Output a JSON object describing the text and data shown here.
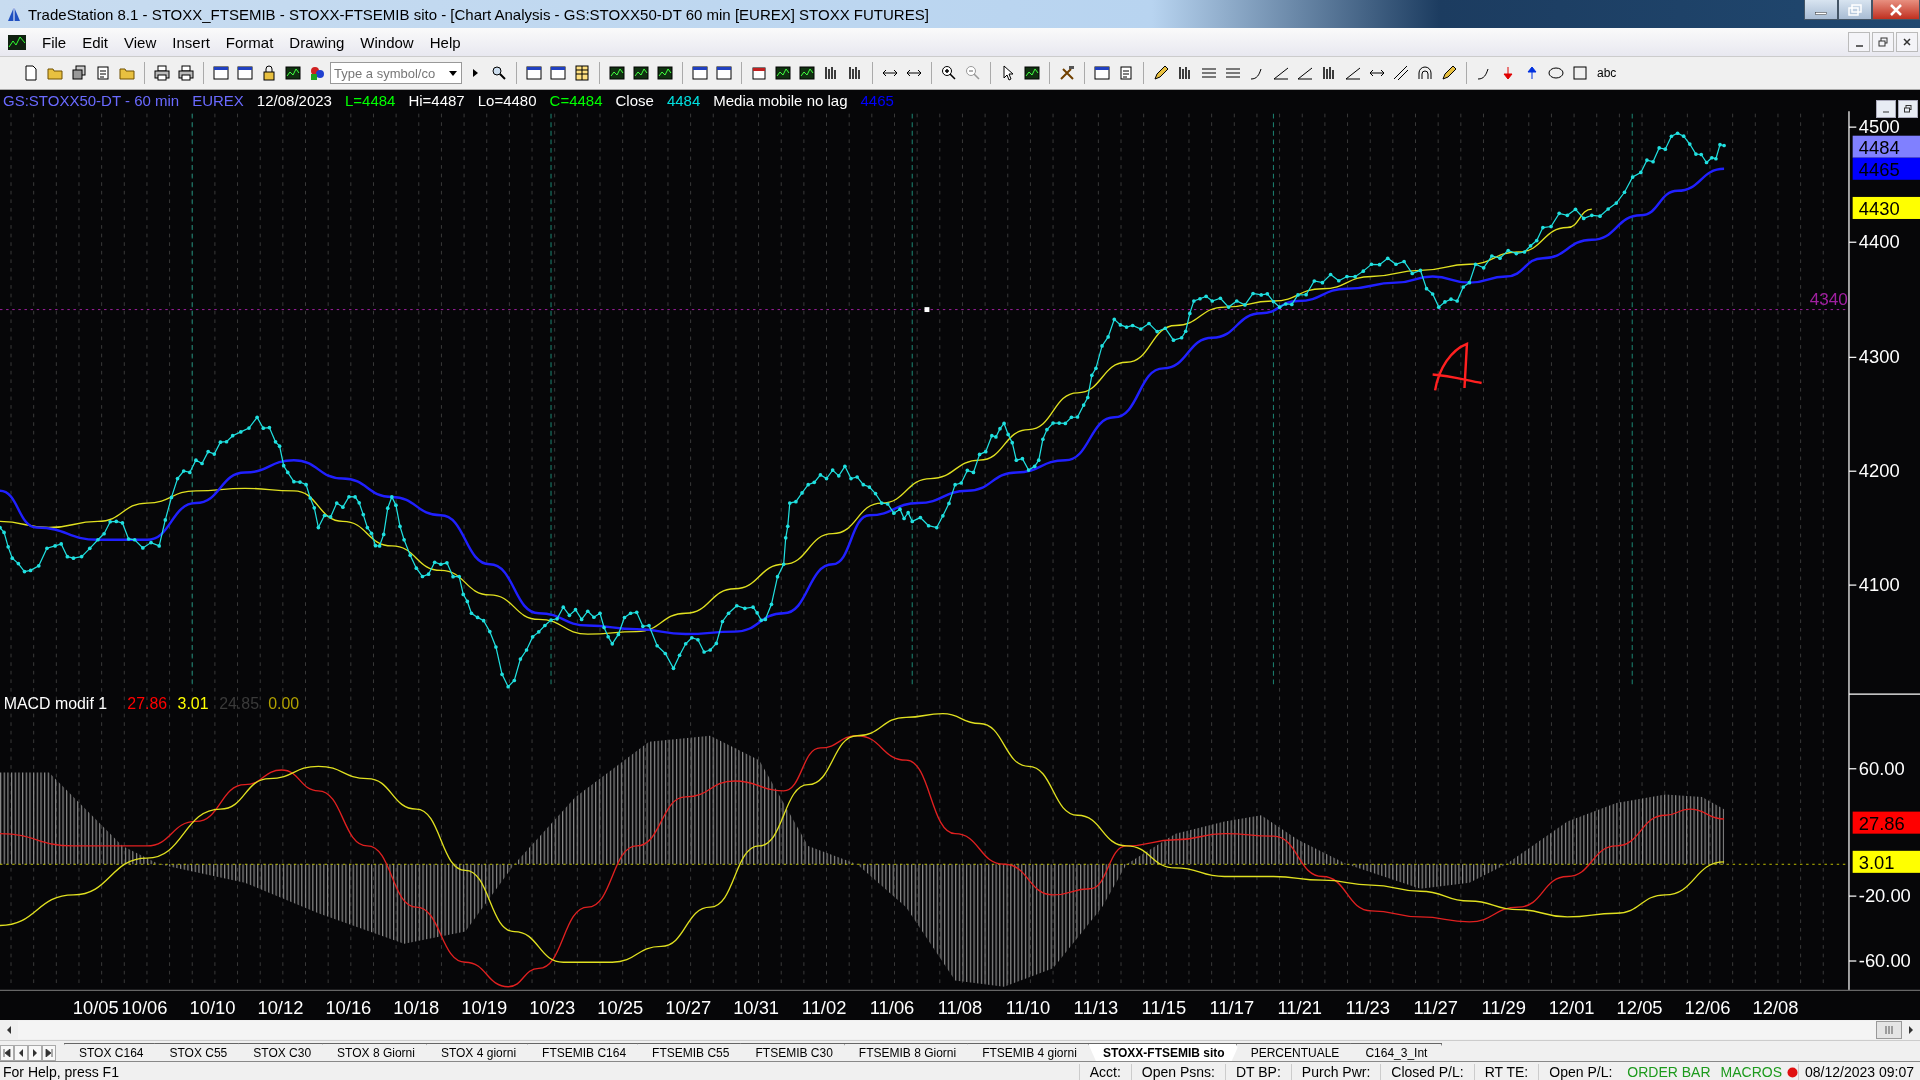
{
  "window": {
    "title": "TradeStation 8.1 - STOXX_FTSEMIB - STOXX-FTSEMIB sito - [Chart Analysis - GS:STOXX50-DT  60 min  [EUREX] STOXX FUTURES]"
  },
  "menu": [
    "File",
    "Edit",
    "View",
    "Insert",
    "Format",
    "Drawing",
    "Window",
    "Help"
  ],
  "toolbar": {
    "symbol_field": {
      "placeholder": "Type a symbol/co"
    },
    "text_tool": "abc"
  },
  "chart": {
    "header": [
      {
        "text": "GS:STOXX50-DT - 60 min",
        "color": "#6a6aff"
      },
      {
        "text": "EUREX",
        "color": "#6a6aff"
      },
      {
        "text": "12/08/2023",
        "color": "#ffffff"
      },
      {
        "text": "L=4484",
        "color": "#00ff00"
      },
      {
        "text": "Hi=4487",
        "color": "#ffffff"
      },
      {
        "text": "Lo=4480",
        "color": "#ffffff"
      },
      {
        "text": "C=4484",
        "color": "#00ff00"
      },
      {
        "text": "Close",
        "color": "#ffffff"
      },
      {
        "text": "4484",
        "color": "#00e0e0"
      },
      {
        "text": "Media mobile no lag",
        "color": "#ffffff"
      },
      {
        "text": "4465",
        "color": "#0000ff"
      }
    ],
    "price_axis": [
      "4500",
      "4400",
      "4300",
      "4200",
      "4100"
    ],
    "price_badges": [
      {
        "text": "4484",
        "color": "#8080ff"
      },
      {
        "text": "4465",
        "color": "#0000ff"
      },
      {
        "text": "4430",
        "color": "#ffff00"
      }
    ],
    "level_line_label": "4340",
    "macd": {
      "title": "MACD modif 1",
      "values": [
        {
          "text": "27.86",
          "color": "#ff0000"
        },
        {
          "text": "3.01",
          "color": "#ffff00"
        },
        {
          "text": "24.85",
          "color": "#3a3a3a"
        },
        {
          "text": "0.00",
          "color": "#b0a000"
        }
      ],
      "axis": [
        "60.00",
        "-20.00",
        "-60.00"
      ],
      "badges": [
        {
          "text": "27.86",
          "color": "#ff0000"
        },
        {
          "text": "3.01",
          "color": "#ffff00"
        }
      ]
    },
    "dates": [
      "10/05",
      "10/06",
      "10/10",
      "10/12",
      "10/16",
      "10/18",
      "10/19",
      "10/23",
      "10/25",
      "10/27",
      "10/31",
      "11/02",
      "11/06",
      "11/08",
      "11/10",
      "11/13",
      "11/15",
      "11/17",
      "11/21",
      "11/23",
      "11/27",
      "11/29",
      "12/01",
      "12/05",
      "12/06",
      "12/08"
    ]
  },
  "tabs": [
    {
      "label": "STOX C164",
      "selected": false
    },
    {
      "label": "STOX C55",
      "selected": false
    },
    {
      "label": "STOX  C30",
      "selected": false
    },
    {
      "label": "STOX  8 Giorni",
      "selected": false
    },
    {
      "label": "STOX 4 giorni",
      "selected": false
    },
    {
      "label": "FTSEMIB C164",
      "selected": false
    },
    {
      "label": "FTSEMIB C55",
      "selected": false
    },
    {
      "label": "FTSEMIB C30",
      "selected": false
    },
    {
      "label": "FTSEMIB  8 Giorni",
      "selected": false
    },
    {
      "label": "FTSEMIB  4 giorni",
      "selected": false
    },
    {
      "label": "STOXX-FTSEMIB sito",
      "selected": true
    },
    {
      "label": "PERCENTUALE",
      "selected": false
    },
    {
      "label": "C164_3_Int",
      "selected": false
    }
  ],
  "status_bar": {
    "help": "For Help, press F1",
    "fields": [
      "Acct:",
      "Open Psns:",
      "DT BP:",
      "Purch Pwr:",
      "Closed P/L:",
      "RT TE:",
      "Open P/L:"
    ],
    "links": [
      "ORDER BAR",
      "MACROS"
    ],
    "clock": "08/12/2023 09:07"
  }
}
